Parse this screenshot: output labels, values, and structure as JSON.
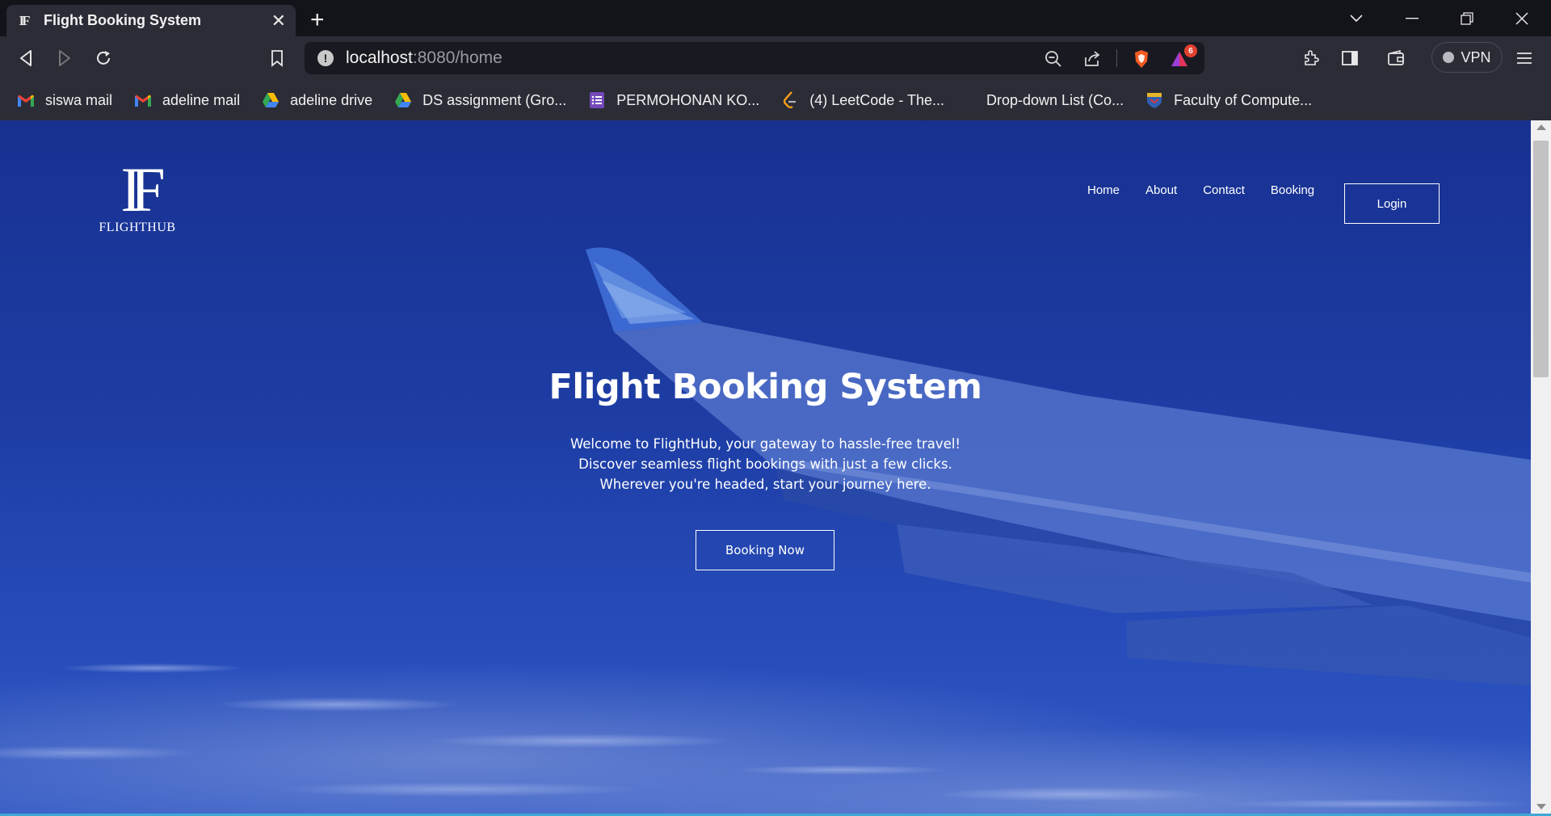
{
  "browser": {
    "tab": {
      "title": "Flight Booking System",
      "favicon": "flighthub-logo-icon"
    },
    "address": {
      "host": "localhost",
      "path": ":8080/home"
    },
    "vpn_label": "VPN",
    "shields_badge": "6",
    "bookmarks": [
      {
        "label": "siswa mail",
        "icon": "gmail-icon"
      },
      {
        "label": "adeline mail",
        "icon": "gmail-icon"
      },
      {
        "label": "adeline drive",
        "icon": "google-drive-icon"
      },
      {
        "label": "DS assignment (Gro...",
        "icon": "google-drive-icon"
      },
      {
        "label": "PERMOHONAN KO...",
        "icon": "google-forms-icon"
      },
      {
        "label": "(4) LeetCode - The...",
        "icon": "leetcode-icon"
      },
      {
        "label": "Drop-down List (Co...",
        "icon": ""
      },
      {
        "label": "Faculty of Compute...",
        "icon": "university-crest-icon"
      }
    ]
  },
  "site": {
    "logo_text": "FLIGHTHUB",
    "nav": [
      "Home",
      "About",
      "Contact",
      "Booking"
    ],
    "login_label": "Login",
    "hero": {
      "title": "Flight Booking System",
      "description_lines": [
        "Welcome to FlightHub, your gateway to hassle-free travel!",
        "Discover seamless flight bookings with just a few clicks.",
        "Wherever you're headed, start your journey here."
      ],
      "cta_label": "Booking Now"
    }
  },
  "colors": {
    "hero_overlay": "#1c3aa0",
    "browser_chrome": "#2b2c36",
    "tabstrip": "#13131a",
    "accent_line": "#3fa7d6"
  }
}
